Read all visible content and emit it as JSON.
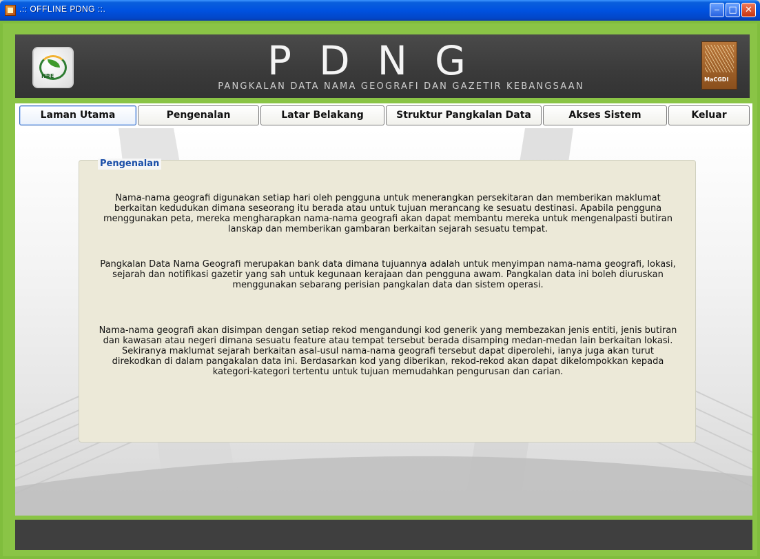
{
  "window": {
    "title": ".:: OFFLINE PDNG ::."
  },
  "banner": {
    "title": "PDNG",
    "subtitle": "PANGKALAN DATA NAMA GEOGRAFI DAN GAZETIR KEBANGSAAN",
    "left_logo_text": "NRE",
    "right_logo_text": "MaCGDI"
  },
  "tabs": [
    {
      "label": "Laman Utama",
      "active": true
    },
    {
      "label": "Pengenalan",
      "active": false
    },
    {
      "label": "Latar Belakang",
      "active": false
    },
    {
      "label": "Struktur Pangkalan Data",
      "active": false
    },
    {
      "label": "Akses Sistem",
      "active": false
    },
    {
      "label": "Keluar",
      "active": false
    }
  ],
  "section": {
    "legend": "Pengenalan",
    "paragraphs": [
      "Nama-nama geografi digunakan setiap hari oleh pengguna untuk menerangkan persekitaran dan memberikan maklumat berkaitan kedudukan dimana seseorang itu berada atau untuk tujuan merancang ke sesuatu destinasi. Apabila pengguna menggunakan peta, mereka mengharapkan nama-nama geografi akan dapat membantu mereka untuk mengenalpasti butiran lanskap dan memberikan gambaran berkaitan sejarah sesuatu tempat.",
      "Pangkalan Data Nama Geografi merupakan bank data dimana tujuannya adalah untuk menyimpan nama-nama geografi, lokasi, sejarah dan notifikasi gazetir yang sah untuk kegunaan kerajaan dan pengguna awam. Pangkalan data ini boleh diuruskan menggunakan sebarang perisian pangkalan data dan sistem operasi.",
      "Nama-nama geografi akan disimpan dengan setiap rekod mengandungi kod generik yang membezakan jenis entiti, jenis butiran dan kawasan atau negeri dimana sesuatu feature atau tempat tersebut berada disamping medan-medan lain berkaitan lokasi. Sekiranya maklumat sejarah berkaitan asal-usul nama-nama geografi tersebut dapat diperolehi, ianya juga akan turut direkodkan di dalam pangakalan data ini. Berdasarkan kod yang diberikan, rekod-rekod akan dapat dikelompokkan kepada kategori-kategori tertentu untuk tujuan memudahkan pengurusan dan carian."
    ]
  },
  "colors": {
    "frame": "#8ac446",
    "banner": "#3a3a3a",
    "legend": "#1a4ea8",
    "panel": "#ece9d8"
  },
  "icons": {
    "app": "app-icon",
    "minimize": "minimize-icon",
    "maximize": "maximize-icon",
    "close": "close-icon"
  }
}
